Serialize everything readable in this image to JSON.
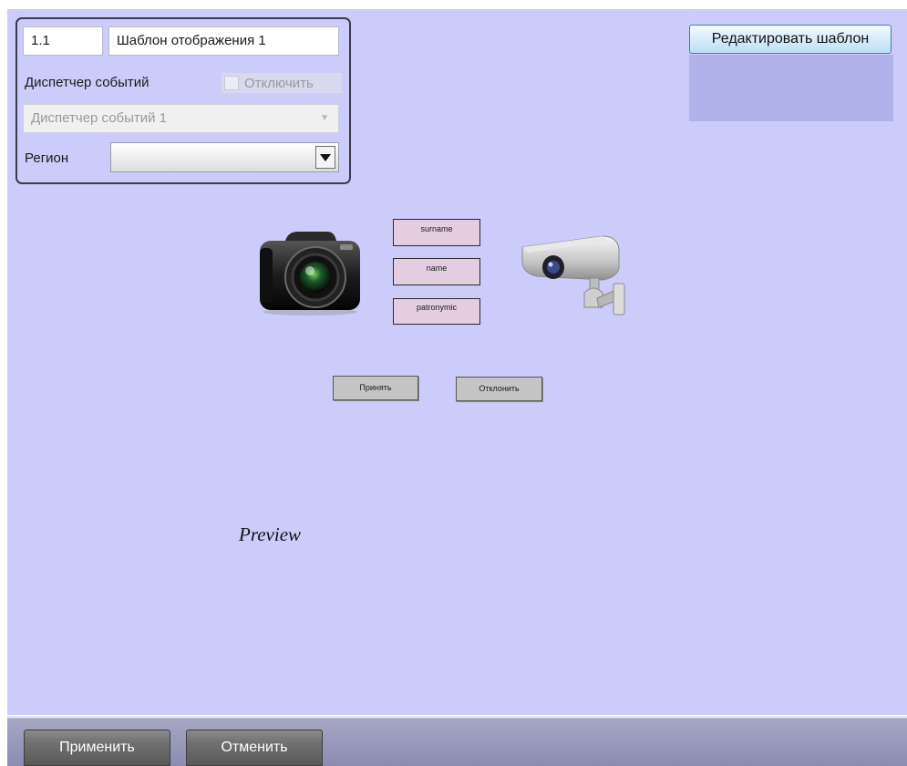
{
  "props": {
    "id_value": "1.1",
    "name_value": "Шаблон отображения 1",
    "event_dispatcher_label": "Диспетчер событий",
    "disable_label": "Отключить",
    "dispatcher_value": "Диспетчер событий 1",
    "region_label": "Регион",
    "region_value": ""
  },
  "edit_template_button": "Редактировать шаблон",
  "template": {
    "fields": [
      "surname",
      "name",
      "patronymic"
    ],
    "accept_label": "Принять",
    "reject_label": "Отклонить",
    "preview_label": "Preview",
    "icons": [
      "photo-camera-icon",
      "security-camera-icon"
    ]
  },
  "footer": {
    "apply_label": "Применить",
    "cancel_label": "Отменить"
  },
  "colors": {
    "canvas_bg": "#ccccfa",
    "field_bg": "#e4cde0",
    "footer_button": "#6e6e6e"
  }
}
